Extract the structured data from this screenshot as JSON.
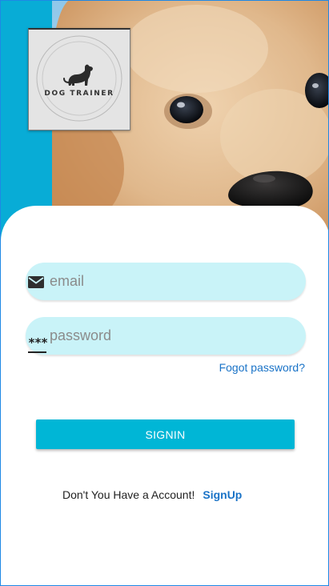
{
  "logo": {
    "text": "DOG TRAINER",
    "icon": "dog-silhouette-icon"
  },
  "form": {
    "email": {
      "placeholder": "email",
      "value": "",
      "icon": "envelope-icon"
    },
    "password": {
      "placeholder": "password",
      "value": "",
      "icon_text": "***"
    },
    "forgot_link": "Fogot password?",
    "signin_button": "SIGNIN",
    "signup_prompt": "Don't You Have a Account!",
    "signup_link": "SignUp"
  },
  "colors": {
    "accent": "#08acd6",
    "button": "#00b6d6",
    "field_background": "#c9f3f8",
    "link": "#1a73c7"
  }
}
